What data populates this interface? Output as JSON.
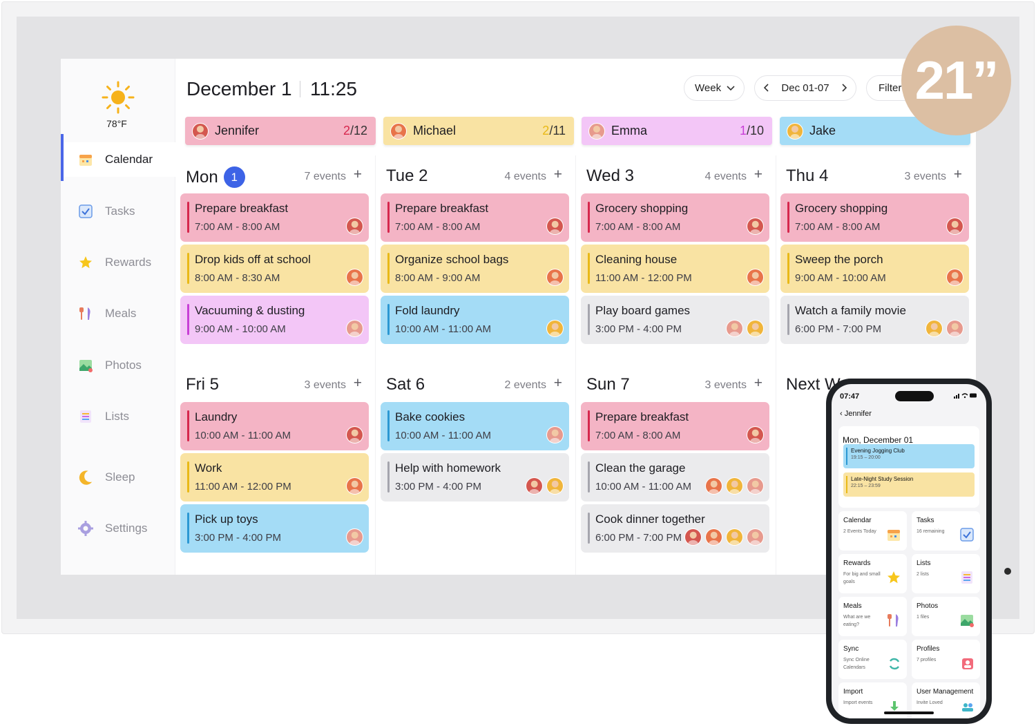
{
  "sidebar": {
    "temperature": "78°F",
    "items": [
      {
        "label": "Calendar",
        "icon": "calendar-icon",
        "active": true
      },
      {
        "label": "Tasks",
        "icon": "checkbox-icon",
        "active": false
      },
      {
        "label": "Rewards",
        "icon": "star-icon",
        "active": false
      },
      {
        "label": "Meals",
        "icon": "utensils-icon",
        "active": false
      },
      {
        "label": "Photos",
        "icon": "photo-icon",
        "active": false
      },
      {
        "label": "Lists",
        "icon": "list-icon",
        "active": false
      },
      {
        "label": "Sleep",
        "icon": "moon-icon",
        "active": false
      },
      {
        "label": "Settings",
        "icon": "gear-icon",
        "active": false
      }
    ]
  },
  "header": {
    "date": "December 1",
    "time": "11:25",
    "view": "Week",
    "range": "Dec 01-07",
    "filter": "Filter"
  },
  "members": [
    {
      "name": "Jennifer",
      "done": "2",
      "total": "/12",
      "color": "#f4b4c5",
      "accent": "#d6274d"
    },
    {
      "name": "Michael",
      "done": "2",
      "total": "/11",
      "color": "#f9e3a3",
      "accent": "#e9b917"
    },
    {
      "name": "Emma",
      "done": "1",
      "total": "/10",
      "color": "#f3c6f7",
      "accent": "#c83fd6"
    },
    {
      "name": "Jake",
      "done": "",
      "total": "",
      "color": "#a4dcf6",
      "accent": "#2c98d3"
    }
  ],
  "days": [
    {
      "name": "Mon",
      "badge": "1",
      "count": "7 events",
      "events": [
        {
          "title": "Prepare breakfast",
          "time": "7:00 AM - 8:00 AM",
          "color": "pink",
          "people": [
            "jennifer"
          ]
        },
        {
          "title": "Drop kids off at school",
          "time": "8:00 AM - 8:30 AM",
          "color": "yellow",
          "people": [
            "michael"
          ]
        },
        {
          "title": "Vacuuming & dusting",
          "time": "9:00 AM - 10:00 AM",
          "color": "purple",
          "people": [
            "emma"
          ]
        }
      ]
    },
    {
      "name": "Tue 2",
      "badge": "",
      "count": "4 events",
      "events": [
        {
          "title": "Prepare breakfast",
          "time": "7:00 AM - 8:00 AM",
          "color": "pink",
          "people": [
            "jennifer"
          ]
        },
        {
          "title": "Organize school bags",
          "time": "8:00 AM - 9:00 AM",
          "color": "yellow",
          "people": [
            "michael"
          ]
        },
        {
          "title": "Fold laundry",
          "time": "10:00 AM - 11:00 AM",
          "color": "blue",
          "people": [
            "jake"
          ]
        }
      ]
    },
    {
      "name": "Wed 3",
      "badge": "",
      "count": "4 events",
      "events": [
        {
          "title": "Grocery shopping",
          "time": "7:00 AM - 8:00 AM",
          "color": "pink",
          "people": [
            "jennifer"
          ]
        },
        {
          "title": "Cleaning house",
          "time": "11:00 AM - 12:00 PM",
          "color": "yellow",
          "people": [
            "michael"
          ]
        },
        {
          "title": "Play board games",
          "time": "3:00 PM - 4:00 PM",
          "color": "gray",
          "people": [
            "emma",
            "jake"
          ]
        }
      ]
    },
    {
      "name": "Thu 4",
      "badge": "",
      "count": "3 events",
      "events": [
        {
          "title": "Grocery shopping",
          "time": "7:00 AM - 8:00 AM",
          "color": "pink",
          "people": [
            "jennifer"
          ]
        },
        {
          "title": "Sweep the porch",
          "time": "9:00 AM - 10:00 AM",
          "color": "yellow",
          "people": [
            "michael"
          ]
        },
        {
          "title": "Watch a family movie",
          "time": "6:00 PM - 7:00 PM",
          "color": "gray",
          "people": [
            "jake",
            "emma"
          ]
        }
      ]
    },
    {
      "name": "Fri 5",
      "badge": "",
      "count": "3 events",
      "events": [
        {
          "title": "Laundry",
          "time": "10:00 AM - 11:00 AM",
          "color": "pink",
          "people": [
            "jennifer"
          ]
        },
        {
          "title": "Work",
          "time": "11:00 AM - 12:00 PM",
          "color": "yellow",
          "people": [
            "michael"
          ]
        },
        {
          "title": "Pick up toys",
          "time": "3:00 PM - 4:00 PM",
          "color": "blue",
          "people": [
            "emma"
          ]
        }
      ]
    },
    {
      "name": "Sat 6",
      "badge": "",
      "count": "2 events",
      "events": [
        {
          "title": "Bake cookies",
          "time": "10:00 AM - 11:00 AM",
          "color": "blue",
          "people": [
            "emma"
          ]
        },
        {
          "title": "Help with homework",
          "time": "3:00 PM - 4:00 PM",
          "color": "gray",
          "people": [
            "jennifer",
            "jake"
          ]
        }
      ]
    },
    {
      "name": "Sun 7",
      "badge": "",
      "count": "3 events",
      "events": [
        {
          "title": "Prepare breakfast",
          "time": "7:00 AM - 8:00 AM",
          "color": "pink",
          "people": [
            "jennifer"
          ]
        },
        {
          "title": "Clean the garage",
          "time": "10:00 AM - 11:00 AM",
          "color": "gray",
          "people": [
            "michael",
            "jake",
            "emma"
          ]
        },
        {
          "title": "Cook dinner together",
          "time": "6:00 PM - 7:00 PM",
          "color": "gray",
          "people": [
            "jennifer",
            "michael",
            "jake",
            "emma"
          ]
        }
      ]
    },
    {
      "name": "Next W",
      "badge": "",
      "count": "",
      "events": []
    }
  ],
  "badge": {
    "size": "21”"
  },
  "phone": {
    "clock": "07:47",
    "back": "Jennifer",
    "day_title": "Mon, December 01",
    "events": [
      {
        "title": "Evening Jogging Club",
        "time": "19:15 – 20:00",
        "color": "#a4dcf6",
        "accent": "#2c98d3"
      },
      {
        "title": "Late-Night Study Session",
        "time": "22:15 – 23:59",
        "color": "#f9e3a3",
        "accent": "#e9b917"
      }
    ],
    "tiles": [
      {
        "title": "Calendar",
        "sub": "2 Events Today",
        "icon": "calendar-icon"
      },
      {
        "title": "Tasks",
        "sub": "16 remaining",
        "icon": "checkbox-icon"
      },
      {
        "title": "Rewards",
        "sub": "For big and small goals",
        "icon": "star-icon"
      },
      {
        "title": "Lists",
        "sub": "2 lists",
        "icon": "list-icon"
      },
      {
        "title": "Meals",
        "sub": "What are we eating?",
        "icon": "utensils-icon"
      },
      {
        "title": "Photos",
        "sub": "1 files",
        "icon": "photo-icon"
      },
      {
        "title": "Sync",
        "sub": "Sync Online Calendars",
        "icon": "sync-icon"
      },
      {
        "title": "Profiles",
        "sub": "7 profiles",
        "icon": "profile-icon"
      },
      {
        "title": "Import",
        "sub": "Import events",
        "icon": "import-icon"
      },
      {
        "title": "User Management",
        "sub": "Invite Loved",
        "icon": "users-icon"
      }
    ]
  }
}
